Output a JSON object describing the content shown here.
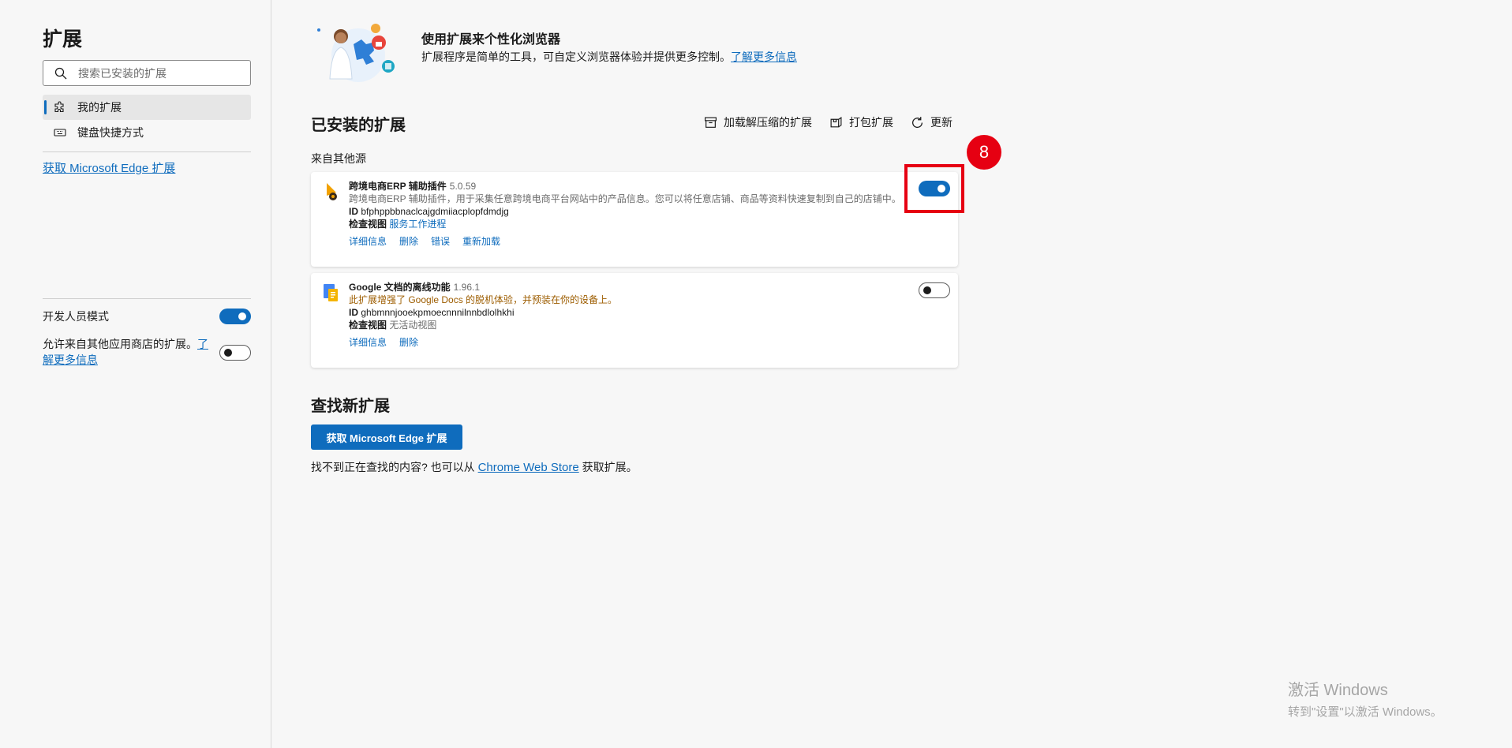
{
  "sidebar": {
    "title": "扩展",
    "search_placeholder": "搜索已安装的扩展",
    "nav": [
      {
        "label": "我的扩展",
        "active": true
      },
      {
        "label": "键盘快捷方式",
        "active": false
      }
    ],
    "store_link": "获取 Microsoft Edge 扩展",
    "dev_mode": {
      "label": "开发人员模式",
      "on": true
    },
    "allow_other": {
      "label_prefix": "允许来自其他应用商店的扩展。",
      "link_a": "了",
      "link_b": "解更多信息",
      "on": false
    }
  },
  "hero": {
    "title": "使用扩展来个性化浏览器",
    "desc": "扩展程序是简单的工具，可自定义浏览器体验并提供更多控制。",
    "link": "了解更多信息"
  },
  "installed": {
    "title": "已安装的扩展",
    "actions": [
      {
        "label": "加载解压缩的扩展",
        "icon": "archive-icon"
      },
      {
        "label": "打包扩展",
        "icon": "package-icon"
      },
      {
        "label": "更新",
        "icon": "refresh-icon"
      }
    ],
    "group_label": "来自其他源",
    "extensions": [
      {
        "name": "跨境电商ERP 辅助插件",
        "version": "5.0.59",
        "desc": "跨境电商ERP 辅助插件，用于采集任意跨境电商平台网站中的产品信息。您可以将任意店铺、商品等资料快速复制到自己的店铺中。",
        "id_label": "ID",
        "id": "bfphppbbnaclcajgdmiiacplopfdmdjg",
        "inspect_label": "检查视图",
        "inspect_value": "服务工作进程",
        "links": [
          "详细信息",
          "删除",
          "错误",
          "重新加载"
        ],
        "enabled": true
      },
      {
        "name": "Google 文档的离线功能",
        "version": "1.96.1",
        "desc": "此扩展增强了 Google Docs 的脱机体验，并预装在你的设备上。",
        "id_label": "ID",
        "id": "ghbmnnjooekpmoecnnnilnnbdlolhkhi",
        "inspect_label": "检查视图",
        "inspect_value": "无活动视图",
        "links": [
          "详细信息",
          "删除"
        ],
        "enabled": false
      }
    ]
  },
  "find": {
    "title": "查找新扩展",
    "button": "获取 Microsoft Edge 扩展",
    "text_a": "找不到正在查找的内容? 也可以从",
    "link": "Chrome Web Store",
    "text_b": "获取扩展。"
  },
  "annotation": {
    "badge": "8",
    "color": "#e60012"
  },
  "watermark": {
    "line1": "激活 Windows",
    "line2": "转到\"设置\"以激活 Windows。"
  },
  "colors": {
    "accent": "#0f6cbd",
    "warning_text": "#9d5d00"
  }
}
